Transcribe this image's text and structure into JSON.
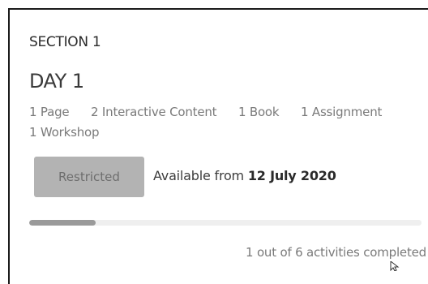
{
  "section": {
    "label": "SECTION 1",
    "day_title": "DAY 1"
  },
  "summary": {
    "items": [
      "1 Page",
      "2 Interactive Content",
      "1 Book",
      "1 Assignment",
      "1 Workshop"
    ]
  },
  "status": {
    "button_label": "Restricted",
    "available_prefix": "Available from ",
    "available_date": "12 July 2020"
  },
  "progress": {
    "fraction": 0.17,
    "text": "1 out of 6 activities completed"
  },
  "colors": {
    "button_bg": "#b3b3b3",
    "progress_fill": "#9a9a9a",
    "progress_track": "#efefef"
  },
  "icons": {
    "cursor": "mouse-pointer-icon"
  }
}
